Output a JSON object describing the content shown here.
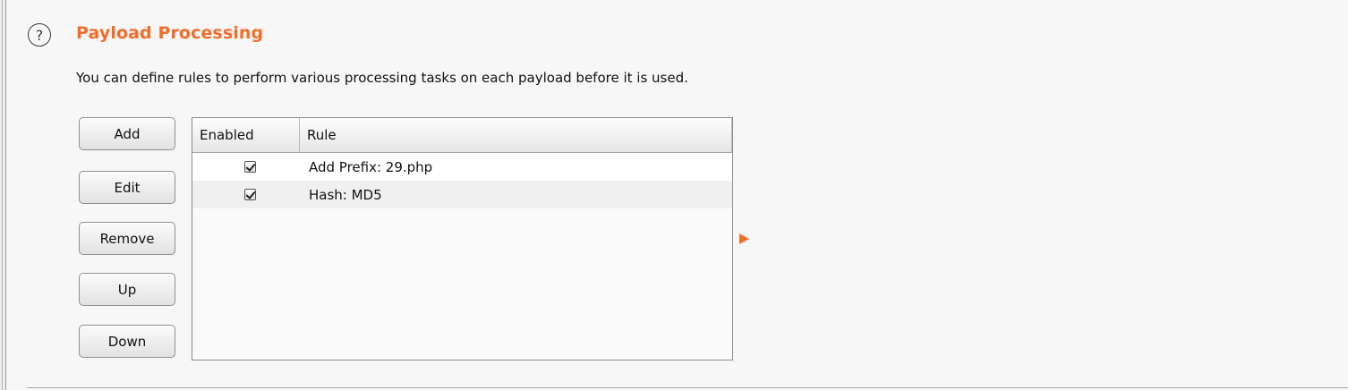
{
  "section": {
    "title": "Payload Processing",
    "description": "You can define rules to perform various processing tasks on each payload before it is used.",
    "help_icon": "question-circle-icon"
  },
  "buttons": {
    "add": "Add",
    "edit": "Edit",
    "remove": "Remove",
    "up": "Up",
    "down": "Down"
  },
  "table": {
    "columns": [
      "Enabled",
      "Rule"
    ],
    "rows": [
      {
        "enabled": true,
        "rule": "Add Prefix: 29.php"
      },
      {
        "enabled": true,
        "rule": "Hash: MD5"
      }
    ]
  },
  "colors": {
    "accent": "#f26c2a"
  },
  "icons": {
    "expand": "triangle-right-icon"
  }
}
